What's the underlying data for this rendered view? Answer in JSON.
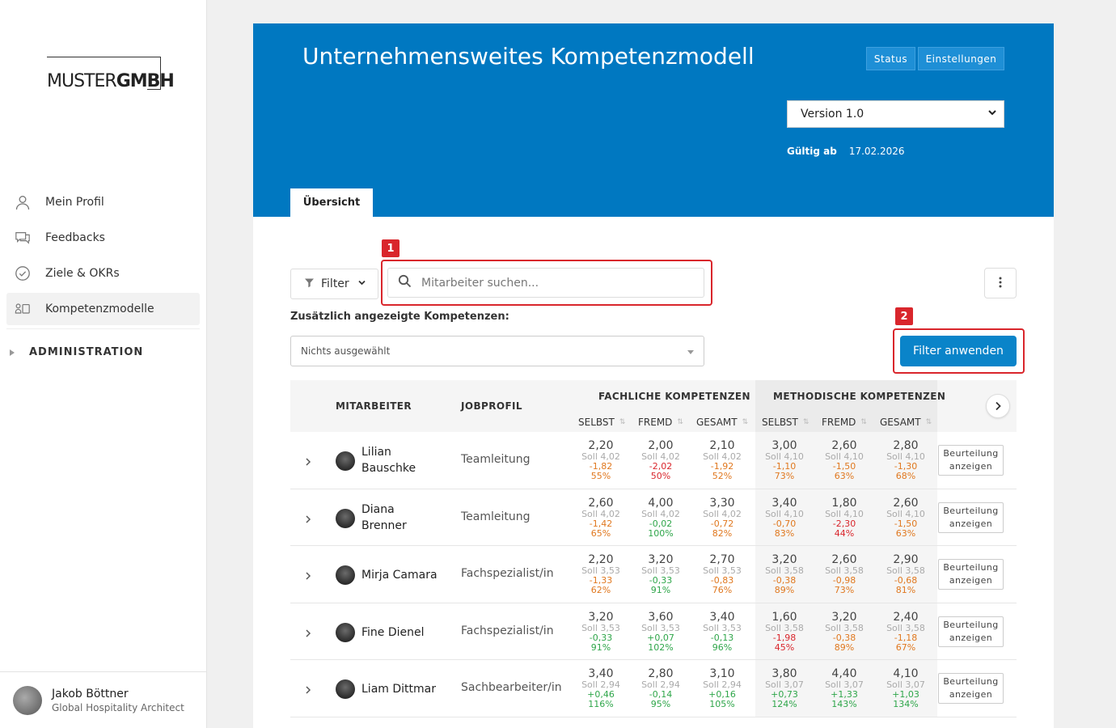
{
  "sidebar": {
    "logo": {
      "part1": "MUSTER",
      "part2": "GMBH"
    },
    "items": [
      {
        "label": "Mein Profil",
        "icon": "user-icon",
        "active": false
      },
      {
        "label": "Feedbacks",
        "icon": "chat-icon",
        "active": false
      },
      {
        "label": "Ziele & OKRs",
        "icon": "check-circle-icon",
        "active": false
      },
      {
        "label": "Kompetenzmodelle",
        "icon": "competence-icon",
        "active": true
      }
    ],
    "admin_label": "ADMINISTRATION",
    "user": {
      "name": "Jakob Böttner",
      "role": "Global Hospitality Architect"
    }
  },
  "header": {
    "title": "Unternehmensweites Kompetenzmodell",
    "status_label": "Status",
    "settings_label": "Einstellungen",
    "version": "Version 1.0",
    "valid_label": "Gültig ab",
    "valid_date": "17.02.2026",
    "tab": "Übersicht"
  },
  "controls": {
    "filter_label": "Filter",
    "search_placeholder": "Mitarbeiter suchen...",
    "additional_label": "Zusätzlich angezeigte Kompetenzen:",
    "multiselect_value": "Nichts ausgewählt",
    "apply_label": "Filter anwenden",
    "annotation_1": "1",
    "annotation_2": "2"
  },
  "table": {
    "col_employee": "MITARBEITER",
    "col_job": "JOBPROFIL",
    "group_fach": "FACHLICHE KOMPETENZEN",
    "group_meth": "METHODISCHE KOMPETENZEN",
    "sub": [
      "SELBST",
      "FREMD",
      "GESAMT",
      "SELBST",
      "FREMD",
      "GESAMT"
    ],
    "button_label_1": "Beurteilung",
    "button_label_2": "anzeigen",
    "rows": [
      {
        "name": "Lilian Bauschke",
        "name_lines": [
          "Lilian",
          "Bauschke"
        ],
        "job": "Teamleitung",
        "cells": [
          {
            "val": "2,20",
            "soll": "Soll 4,02",
            "diff": "-1,82",
            "pct": "55%",
            "color": "#e0781f"
          },
          {
            "val": "2,00",
            "soll": "Soll 4,02",
            "diff": "-2,02",
            "pct": "50%",
            "color": "#d9262c"
          },
          {
            "val": "2,10",
            "soll": "Soll 4,02",
            "diff": "-1,92",
            "pct": "52%",
            "color": "#e0781f"
          },
          {
            "val": "3,00",
            "soll": "Soll 4,10",
            "diff": "-1,10",
            "pct": "73%",
            "color": "#e0781f"
          },
          {
            "val": "2,60",
            "soll": "Soll 4,10",
            "diff": "-1,50",
            "pct": "63%",
            "color": "#e0781f"
          },
          {
            "val": "2,80",
            "soll": "Soll 4,10",
            "diff": "-1,30",
            "pct": "68%",
            "color": "#e0781f"
          }
        ]
      },
      {
        "name": "Diana Brenner",
        "name_lines": [
          "Diana",
          "Brenner"
        ],
        "job": "Teamleitung",
        "cells": [
          {
            "val": "2,60",
            "soll": "Soll 4,02",
            "diff": "-1,42",
            "pct": "65%",
            "color": "#e0781f"
          },
          {
            "val": "4,00",
            "soll": "Soll 4,02",
            "diff": "-0,02",
            "pct": "100%",
            "color": "#2fa64a"
          },
          {
            "val": "3,30",
            "soll": "Soll 4,02",
            "diff": "-0,72",
            "pct": "82%",
            "color": "#e0781f"
          },
          {
            "val": "3,40",
            "soll": "Soll 4,10",
            "diff": "-0,70",
            "pct": "83%",
            "color": "#e0781f"
          },
          {
            "val": "1,80",
            "soll": "Soll 4,10",
            "diff": "-2,30",
            "pct": "44%",
            "color": "#d9262c"
          },
          {
            "val": "2,60",
            "soll": "Soll 4,10",
            "diff": "-1,50",
            "pct": "63%",
            "color": "#e0781f"
          }
        ]
      },
      {
        "name": "Mirja Camara",
        "name_lines": [
          "Mirja Camara"
        ],
        "job": "Fachspezialist/in",
        "cells": [
          {
            "val": "2,20",
            "soll": "Soll 3,53",
            "diff": "-1,33",
            "pct": "62%",
            "color": "#e0781f"
          },
          {
            "val": "3,20",
            "soll": "Soll 3,53",
            "diff": "-0,33",
            "pct": "91%",
            "color": "#2fa64a"
          },
          {
            "val": "2,70",
            "soll": "Soll 3,53",
            "diff": "-0,83",
            "pct": "76%",
            "color": "#e0781f"
          },
          {
            "val": "3,20",
            "soll": "Soll 3,58",
            "diff": "-0,38",
            "pct": "89%",
            "color": "#e0781f"
          },
          {
            "val": "2,60",
            "soll": "Soll 3,58",
            "diff": "-0,98",
            "pct": "73%",
            "color": "#e0781f"
          },
          {
            "val": "2,90",
            "soll": "Soll 3,58",
            "diff": "-0,68",
            "pct": "81%",
            "color": "#e0781f"
          }
        ]
      },
      {
        "name": "Fine Dienel",
        "name_lines": [
          "Fine Dienel"
        ],
        "job": "Fachspezialist/in",
        "cells": [
          {
            "val": "3,20",
            "soll": "Soll 3,53",
            "diff": "-0,33",
            "pct": "91%",
            "color": "#2fa64a"
          },
          {
            "val": "3,60",
            "soll": "Soll 3,53",
            "diff": "+0,07",
            "pct": "102%",
            "color": "#2fa64a"
          },
          {
            "val": "3,40",
            "soll": "Soll 3,53",
            "diff": "-0,13",
            "pct": "96%",
            "color": "#2fa64a"
          },
          {
            "val": "1,60",
            "soll": "Soll 3,58",
            "diff": "-1,98",
            "pct": "45%",
            "color": "#d9262c"
          },
          {
            "val": "3,20",
            "soll": "Soll 3,58",
            "diff": "-0,38",
            "pct": "89%",
            "color": "#e0781f"
          },
          {
            "val": "2,40",
            "soll": "Soll 3,58",
            "diff": "-1,18",
            "pct": "67%",
            "color": "#e0781f"
          }
        ]
      },
      {
        "name": "Liam Dittmar",
        "name_lines": [
          "Liam Dittmar"
        ],
        "job": "Sachbearbeiter/in",
        "cells": [
          {
            "val": "3,40",
            "soll": "Soll 2,94",
            "diff": "+0,46",
            "pct": "116%",
            "color": "#2fa64a"
          },
          {
            "val": "2,80",
            "soll": "Soll 2,94",
            "diff": "-0,14",
            "pct": "95%",
            "color": "#2fa64a"
          },
          {
            "val": "3,10",
            "soll": "Soll 2,94",
            "diff": "+0,16",
            "pct": "105%",
            "color": "#2fa64a"
          },
          {
            "val": "3,80",
            "soll": "Soll 3,07",
            "diff": "+0,73",
            "pct": "124%",
            "color": "#2fa64a"
          },
          {
            "val": "4,40",
            "soll": "Soll 3,07",
            "diff": "+1,33",
            "pct": "143%",
            "color": "#2fa64a"
          },
          {
            "val": "4,10",
            "soll": "Soll 3,07",
            "diff": "+1,03",
            "pct": "134%",
            "color": "#2fa64a"
          }
        ]
      }
    ]
  }
}
